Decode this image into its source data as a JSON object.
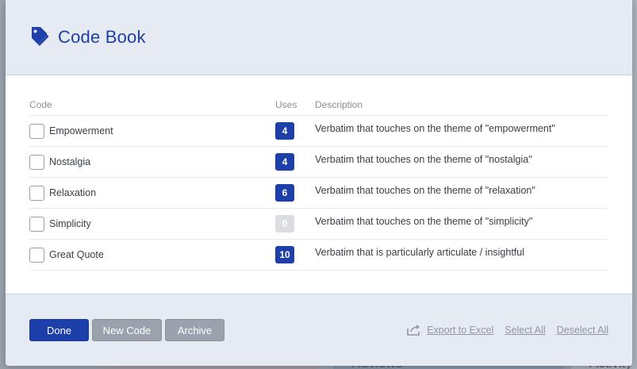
{
  "background": {
    "label_1": "Reviews",
    "label_2": "Activity"
  },
  "header": {
    "title": "Code Book",
    "icon": "tag-icon"
  },
  "table": {
    "columns": {
      "code": "Code",
      "uses": "Uses",
      "description": "Description"
    },
    "rows": [
      {
        "code": "Empowerment",
        "uses": "4",
        "description": "Verbatim that touches on the theme of \"empowerment\""
      },
      {
        "code": "Nostalgia",
        "uses": "4",
        "description": "Verbatim that touches on the theme of \"nostalgia\""
      },
      {
        "code": "Relaxation",
        "uses": "6",
        "description": "Verbatim that touches on the theme of \"relaxation\""
      },
      {
        "code": "Simplicity",
        "uses": "0",
        "description": "Verbatim that touches on the theme of \"simplicity\""
      },
      {
        "code": "Great Quote",
        "uses": "10",
        "description": "Verbatim that is particularly articulate / insightful"
      }
    ]
  },
  "footer": {
    "done_label": "Done",
    "new_code_label": "New Code",
    "archive_label": "Archive",
    "export_label": "Export to Excel",
    "select_all_label": "Select All",
    "deselect_all_label": "Deselect All"
  },
  "colors": {
    "accent": "#1d3faa",
    "header_bg": "#e6eaf3",
    "secondary_button": "#9ba2ad"
  }
}
